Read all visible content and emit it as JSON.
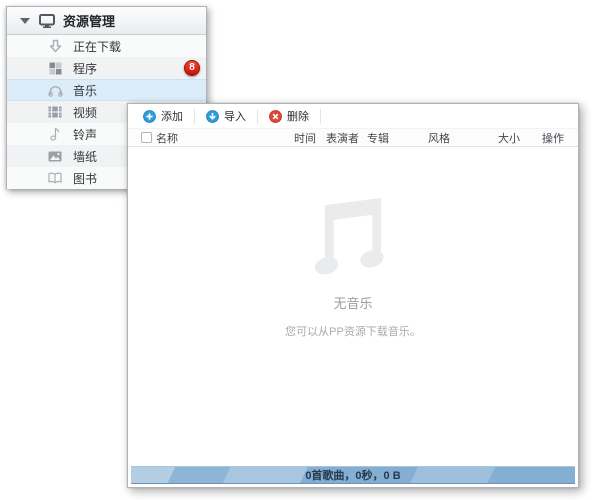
{
  "sidebar": {
    "header": {
      "label": "资源管理",
      "icon": "device-monitor-icon"
    },
    "items": [
      {
        "label": "正在下载",
        "icon": "download-arrow-icon"
      },
      {
        "label": "程序",
        "icon": "apps-grid-icon",
        "badge": "8"
      },
      {
        "label": "音乐",
        "icon": "headphones-icon",
        "selected": true
      },
      {
        "label": "视频",
        "icon": "film-strip-icon"
      },
      {
        "label": "铃声",
        "icon": "music-note-icon"
      },
      {
        "label": "墙纸",
        "icon": "wallpaper-icon"
      },
      {
        "label": "图书",
        "icon": "open-book-icon"
      }
    ]
  },
  "main": {
    "toolbar": {
      "add_label": "添加",
      "import_label": "导入",
      "delete_label": "删除"
    },
    "table": {
      "headers": [
        "名称",
        "时间",
        "表演者",
        "专辑",
        "风格",
        "大小",
        "操作"
      ]
    },
    "empty_state": {
      "title": "无音乐",
      "hint": "您可以从PP资源下载音乐。",
      "icon": "big-music-note-icon"
    },
    "status_bar": {
      "text": "0首歌曲，0秒，0 B"
    }
  },
  "colors": {
    "accent_blue": "#2e9cd6",
    "delete_red": "#dd4a3c",
    "badge_red": "#e01e0f",
    "selected_row_blue": "#dcedf9",
    "status_bar_blue": "#84aed2"
  }
}
